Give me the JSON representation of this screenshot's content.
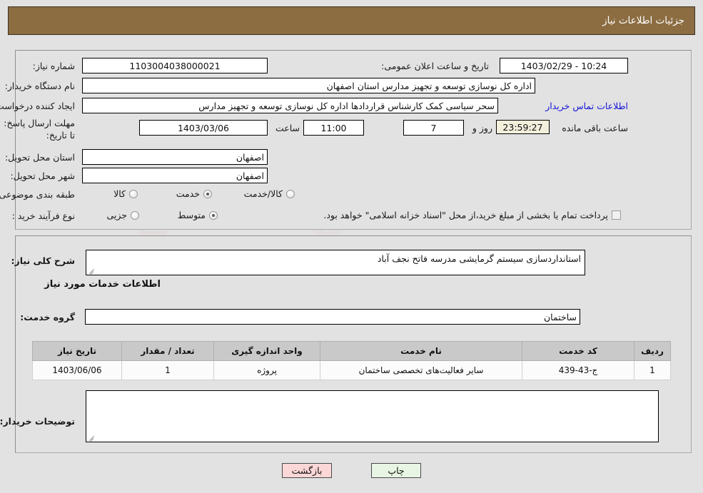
{
  "header": {
    "title": "جزئیات اطلاعات نیاز"
  },
  "top_panel": {
    "need_number_label": "شماره نیاز:",
    "need_number_value": "1103004038000021",
    "announce_label": "تاریخ و ساعت اعلان عمومی:",
    "announce_value": "1403/02/29 - 10:24",
    "buyer_org_label": "نام دستگاه خریدار:",
    "buyer_org_value": "اداره کل نوسازی  توسعه و تجهیز مدارس استان اصفهان",
    "creator_label": "ایجاد کننده درخواست:",
    "creator_value": "سحر سیاسی کمک کارشناس قراردادها اداره کل نوسازی  توسعه و تجهیز مدارس",
    "buyer_contact_link": "اطلاعات تماس خریدار",
    "deadline_label": "مهلت ارسال پاسخ: تا تاریخ:",
    "deadline_date": "1403/03/06",
    "deadline_hour_label": "ساعت",
    "deadline_hour_value": "11:00",
    "remaining_days": "7",
    "remaining_days_label": "روز و",
    "remaining_time": "23:59:27",
    "remaining_time_label": "ساعت باقی مانده",
    "province_label": "استان محل تحویل:",
    "province_value": "اصفهان",
    "city_label": "شهر محل تحویل:",
    "city_value": "اصفهان",
    "category_label": "طبقه بندی موضوعی:",
    "category_options": [
      {
        "label": "کالا",
        "selected": false
      },
      {
        "label": "خدمت",
        "selected": true
      },
      {
        "label": "کالا/خدمت",
        "selected": false
      }
    ],
    "process_label": "نوع فرآیند خرید :",
    "process_options": [
      {
        "label": "جزیی",
        "selected": false
      },
      {
        "label": "متوسط",
        "selected": true
      }
    ],
    "treasury_checkbox_label": "پرداخت تمام یا بخشی از مبلغ خرید،از محل \"اسناد خزانه اسلامی\" خواهد بود.",
    "treasury_checked": false
  },
  "bottom_panel": {
    "overall_desc_label": "شرح کلی نیاز:",
    "overall_desc_value": "استانداردسازی سیستم گرمایشی مدرسه فاتح نجف آباد",
    "services_heading": "اطلاعات خدمات مورد نیاز",
    "service_group_label": "گروه خدمت:",
    "service_group_value": "ساختمان",
    "table": {
      "columns": [
        "ردیف",
        "کد خدمت",
        "نام خدمت",
        "واحد اندازه گیری",
        "تعداد / مقدار",
        "تاریخ نیاز"
      ],
      "rows": [
        {
          "row_no": "1",
          "service_code": "ج-43-439",
          "service_name": "سایر فعالیت‌های تخصصی ساختمان",
          "unit": "پروژه",
          "quantity": "1",
          "need_date": "1403/06/06"
        }
      ]
    },
    "buyer_notes_label": "توضیحات خریدار:",
    "buyer_notes_value": ""
  },
  "footer": {
    "print_label": "چاپ",
    "back_label": "بازگشت"
  },
  "watermark": {
    "text": "AnaTender.net"
  },
  "colors": {
    "header_bar": "#8c6d42",
    "page_bg": "#e2e2e2",
    "link": "#1414d8",
    "print_btn": "#e8f5e4",
    "back_btn": "#fbd7d7",
    "table_header": "#c9c9c9",
    "highlight_field": "#f2efdc"
  }
}
